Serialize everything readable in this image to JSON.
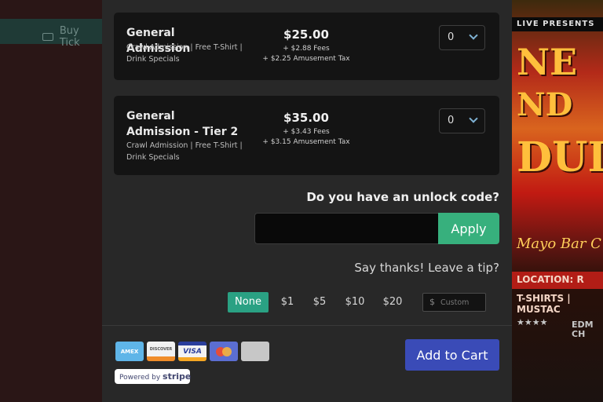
{
  "background": {
    "left_nav_label": "Buy Tick",
    "poster_header": "LIVE PRESENTS",
    "poster_script": "Mayo Bar C",
    "poster_location": "LOCATION: R",
    "poster_items": "T-SHIRTS | MUSTAC",
    "poster_stars": "★★★★",
    "poster_edm": "EDM\nCH"
  },
  "tickets": [
    {
      "name": "General Admission",
      "description": "Crawl Admission | Free T-Shirt | Drink Specials",
      "price": "$25.00",
      "fees": "+ $2.88 Fees",
      "tax": "+ $2.25 Amusement Tax",
      "quantity": "0"
    },
    {
      "name": "General Admission - Tier 2",
      "description": "Crawl Admission | Free T-Shirt | Drink Specials",
      "price": "$35.00",
      "fees": "+ $3.43 Fees",
      "tax": "+ $3.15 Amusement Tax",
      "quantity": "0"
    }
  ],
  "unlock": {
    "question": "Do you have an unlock code?",
    "input_value": "",
    "apply_label": "Apply"
  },
  "tip": {
    "question": "Say thanks! Leave a tip?",
    "options": [
      "None",
      "$1",
      "$5",
      "$10",
      "$20"
    ],
    "selected": "None",
    "custom_currency": "$",
    "custom_placeholder": "Custom"
  },
  "payment": {
    "cards": [
      "AMEX",
      "DISCOVER",
      "VISA",
      "Mastercard",
      "Generic"
    ],
    "stripe_prefix": "Powered by",
    "stripe_brand": "stripe"
  },
  "cart": {
    "button_label": "Add to Cart"
  },
  "colors": {
    "accent_green": "#37b07d",
    "tip_selected": "#2aa183",
    "cart_blue": "#3a4bb7"
  }
}
